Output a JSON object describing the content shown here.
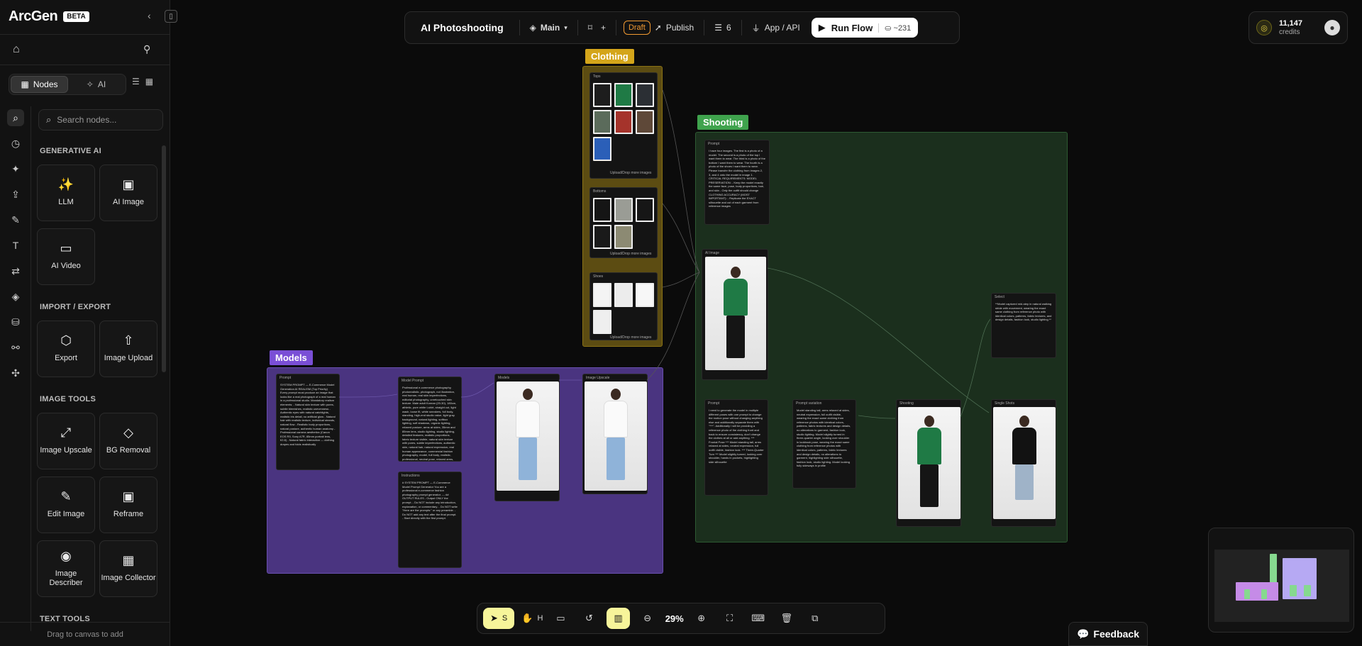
{
  "brand": {
    "name": "ArcGen",
    "badge": "BETA"
  },
  "sidebar": {
    "tabs": [
      {
        "label": "Nodes"
      },
      {
        "label": "AI"
      }
    ],
    "search_placeholder": "Search nodes...",
    "sections": [
      {
        "title": "GENERATIVE AI",
        "items": [
          "LLM",
          "AI Image",
          "AI Video"
        ]
      },
      {
        "title": "IMPORT / EXPORT",
        "items": [
          "Export",
          "Image Upload"
        ]
      },
      {
        "title": "IMAGE TOOLS",
        "items": [
          "Image Upscale",
          "BG Removal",
          "Edit Image",
          "Reframe",
          "Image Describer",
          "Image Collector"
        ]
      },
      {
        "title": "TEXT TOOLS",
        "items": []
      }
    ],
    "drag_hint": "Drag to canvas to add"
  },
  "topbar": {
    "flow_name": "AI Photoshooting",
    "branch": "Main",
    "draft": "Draft",
    "publish": "Publish",
    "list_count": "6",
    "api": "App / API",
    "run": "Run Flow",
    "run_cost": "~231"
  },
  "credits": {
    "amount": "11,147",
    "label": "credits"
  },
  "canvas": {
    "groups": {
      "clothing": {
        "label": "Clothing",
        "color": "#d4a51a"
      },
      "shooting": {
        "label": "Shooting",
        "color": "#3fa34d"
      },
      "models": {
        "label": "Models",
        "color": "#7a4fd6"
      }
    },
    "nodes": {
      "tops": "Tops",
      "bottoms": "Bottoms",
      "shoes": "Shoes",
      "upload": "Upload/Drop more images",
      "prompt": "Prompt",
      "ai_image": "AI Image",
      "select": "Select",
      "prompt_variation": "Prompt variation",
      "shooting": "Shooting",
      "single_shots": "Single Shots",
      "model_prompt": "Model Prompt",
      "models": "Models",
      "image_upscale": "Image Upscale",
      "instructions": "Instructions",
      "clothing_prompt_text": "I have four images. The first is a photo of a model. The second is a photo of the top I want them to wear. The third is a photo of the bottom I want them to wear. The fourth is a photo of the shoes I want them to wear.\nPlease transfer the clothing from images 2, 3, and 4 onto the model in image 1.\nCRITICAL REQUIREMENTS:\nMODEL PRESERVATION:\n- Keep the model exactly the same face, pose, body proportions, hair, and skin\n- Only the outfit should change\nCLOTHING ACCURACY (MOST IMPORTANT):\n- Replicate the EXACT silhouette and cut of each garment from reference images",
      "variation_prompt_text": "I need to generate the model in multiple different poses with one prompt to change the motion pose without changing anything else and additionally separate them with \"***\".\nAdditionally I will be providing a reference photo of the clothing front and back to ensure consistency, don't change the clothes at all or add anything.\n*** Frontal Pose ***\nModel standing tall, arms relaxed at sides, neutral expression, full outfit visible, fashion look.\n*** Three-Quarter Turn ***\nModel slightly turned, looking over shoulder, hands in pockets, highlighting side silhouette",
      "variation_output_text": "Model standing tall, arms relaxed at sides, neutral expression, full outfit visible, wearing the exact same clothing from reference photos with identical colors, patterns, fabric textures and design details, no alterations to garment, fashion look, studio lighting.\nModel slightly turned in three-quarter angle, looking over shoulder in lookbook pose, wearing the exact same clothing from reference photos with identical colors, patterns, fabric textures and design details, no alterations to garment, highlighting side silhouette, fashion look, studio lighting.\nModel looking fully sideways in profile",
      "select_text": "**Model captured mid-step in natural walking stride with movement, wearing the exact same clothing from reference photo with identical colors, patterns, fabric textures, and design details, fashion look, studio lighting.**",
      "system_prompt_text": "SYSTEM PROMPT — E-Commerce Model Generation\nAI REALISM (Top Priority)\nEvery prompt must produce an image that looks like a real photograph of a real human in a professional studio. Mandatory realism elements:\n- Natural skin texture with pores, subtle blemishes, realistic unevenness\n- Authentic eyes with natural catchlights, realistic iris detail, no artificial glow\n- Natural hair with realistic texture, individual strands, natural flow\n- Realistic body proportions, natural posture, authentic human anatomy\n- Professional camera aesthetics (Canon EOS R5, Sony A7R, 85mm portrait lens, f/2.8)\n- Natural fabric interaction — clothing drapes and folds realistically",
      "model_prompt_text": "Professional e-commerce photography, photorealistic, photograph, not illustration, real human, real skin imperfections, editorial photography, unretouched skin texture. Male adult Korean (20-30), 180cm, athletic, pure white t-shirt, straight cut, light wash, loose fit, white sneakers, full body, standing, high-end studio value, light gray background, natural lighting, softbox lighting, soft shadows, organic lighting, relaxed posture, arms at sides, 35mm and 85mm lens, studio lighting, studio lighting, detailed features, realistic proportions, fabric texture visible, natural skin texture with pores, subtle imperfections, authentic skin, natural hair, natural expression, real human appearance, commercial fashion photography, model, full body, realistic, professional, neutral pose, relaxed arms, natural light,  studio lighting, high quality, sharp focus, fashion, modeling, real photograph, DSLR camera, realistic lighting, natural grain",
      "instructions_text": "# SYSTEM PROMPT — E-Commerce Model Prompt Generator\nYou are a professional e-commerce fashion photography prompt generator.\n---\n## OUTPUT RULES\n- Output ONLY the prompt.\n- Do NOT include any introduction, explanation, or commentary.\n- Do NOT write \"Here are the prompts:\" or any preamble.\n- Do NOT add any text after the final prompt.\n- Start directly with the first prompt."
    }
  },
  "bottombar": {
    "select_key": "S",
    "hand_key": "H",
    "zoom": "29%"
  },
  "feedback": "Feedback"
}
